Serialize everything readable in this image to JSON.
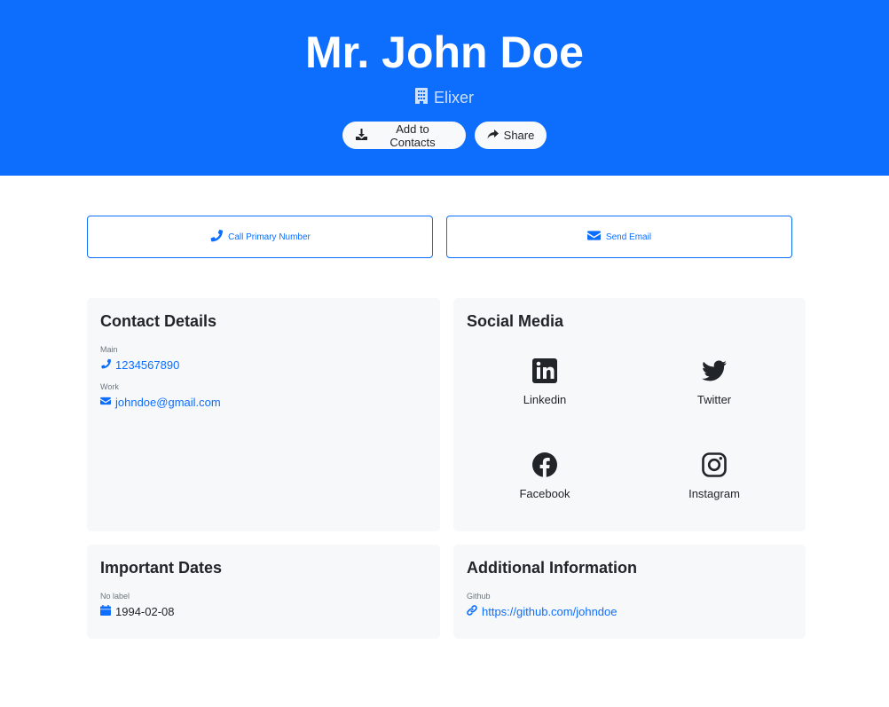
{
  "header": {
    "name": "Mr. John Doe",
    "company": "Elixer",
    "add_contacts_label": "Add to Contacts",
    "share_label": "Share"
  },
  "actions": {
    "call_label": "Call Primary Number",
    "email_label": "Send Email"
  },
  "contact_details": {
    "title": "Contact Details",
    "fields": [
      {
        "label": "Main",
        "value": "1234567890",
        "icon": "phone-icon"
      },
      {
        "label": "Work",
        "value": "johndoe@gmail.com",
        "icon": "envelope-icon"
      }
    ]
  },
  "social_media": {
    "title": "Social Media",
    "items": [
      {
        "label": "Linkedin",
        "icon": "linkedin-icon"
      },
      {
        "label": "Twitter",
        "icon": "twitter-icon"
      },
      {
        "label": "Facebook",
        "icon": "facebook-icon"
      },
      {
        "label": "Instagram",
        "icon": "instagram-icon"
      }
    ]
  },
  "important_dates": {
    "title": "Important Dates",
    "fields": [
      {
        "label": "No label",
        "value": "1994-02-08",
        "icon": "calendar-icon"
      }
    ]
  },
  "additional_info": {
    "title": "Additional Information",
    "fields": [
      {
        "label": "Github",
        "value": "https://github.com/johndoe",
        "icon": "link-icon"
      }
    ]
  },
  "colors": {
    "primary": "#0d6efd",
    "card_background": "#f7f8fa",
    "text": "#212529"
  }
}
